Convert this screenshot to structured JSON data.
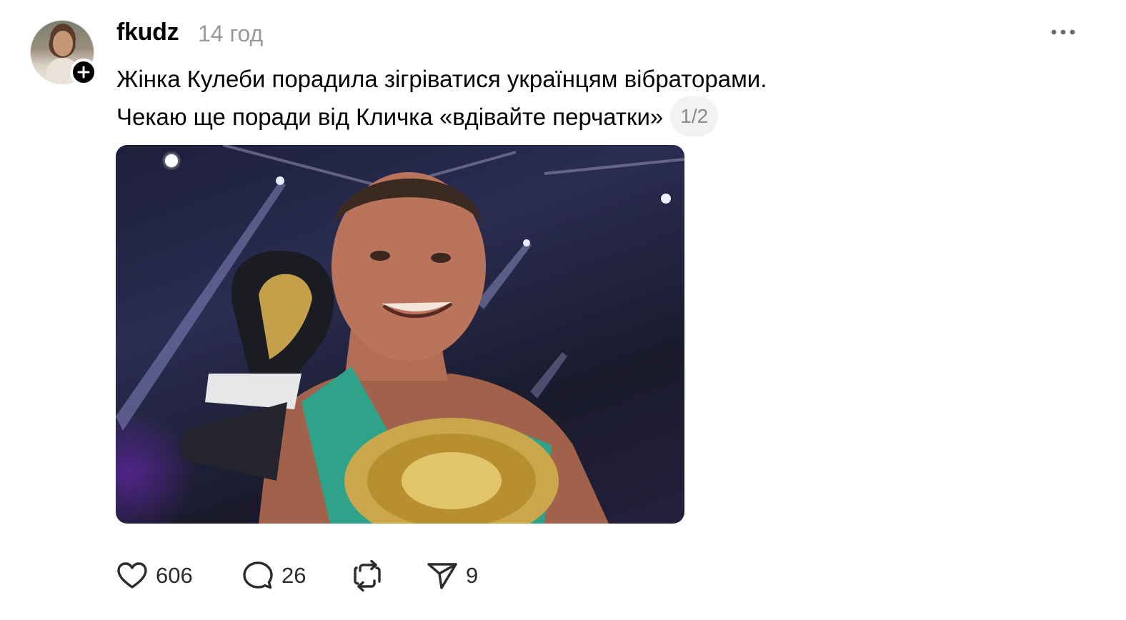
{
  "post": {
    "author": {
      "username": "fkudz",
      "avatar_icon": "user-avatar",
      "follow_icon": "plus-icon"
    },
    "timestamp": "14 год",
    "more_icon": "ellipsis-icon",
    "text_lines": [
      "Жінка Кулеби порадила зігріватися українцям вібраторами.",
      "Чекаю ще поради від Кличка «вдівайте перчатки»"
    ],
    "page_indicator": "1/2",
    "media": {
      "type": "photo",
      "icon": "boxer-with-championship-belt-photo"
    },
    "actions": {
      "like": {
        "icon": "heart-icon",
        "count": "606"
      },
      "reply": {
        "icon": "comment-bubble-icon",
        "count": "26"
      },
      "repost": {
        "icon": "repost-icon"
      },
      "share": {
        "icon": "send-icon",
        "count": "9"
      }
    }
  },
  "colors": {
    "text": "#000000",
    "muted": "#9a9a9a",
    "pill_bg": "#f2f2f2",
    "icon": "#2b2b2b"
  }
}
